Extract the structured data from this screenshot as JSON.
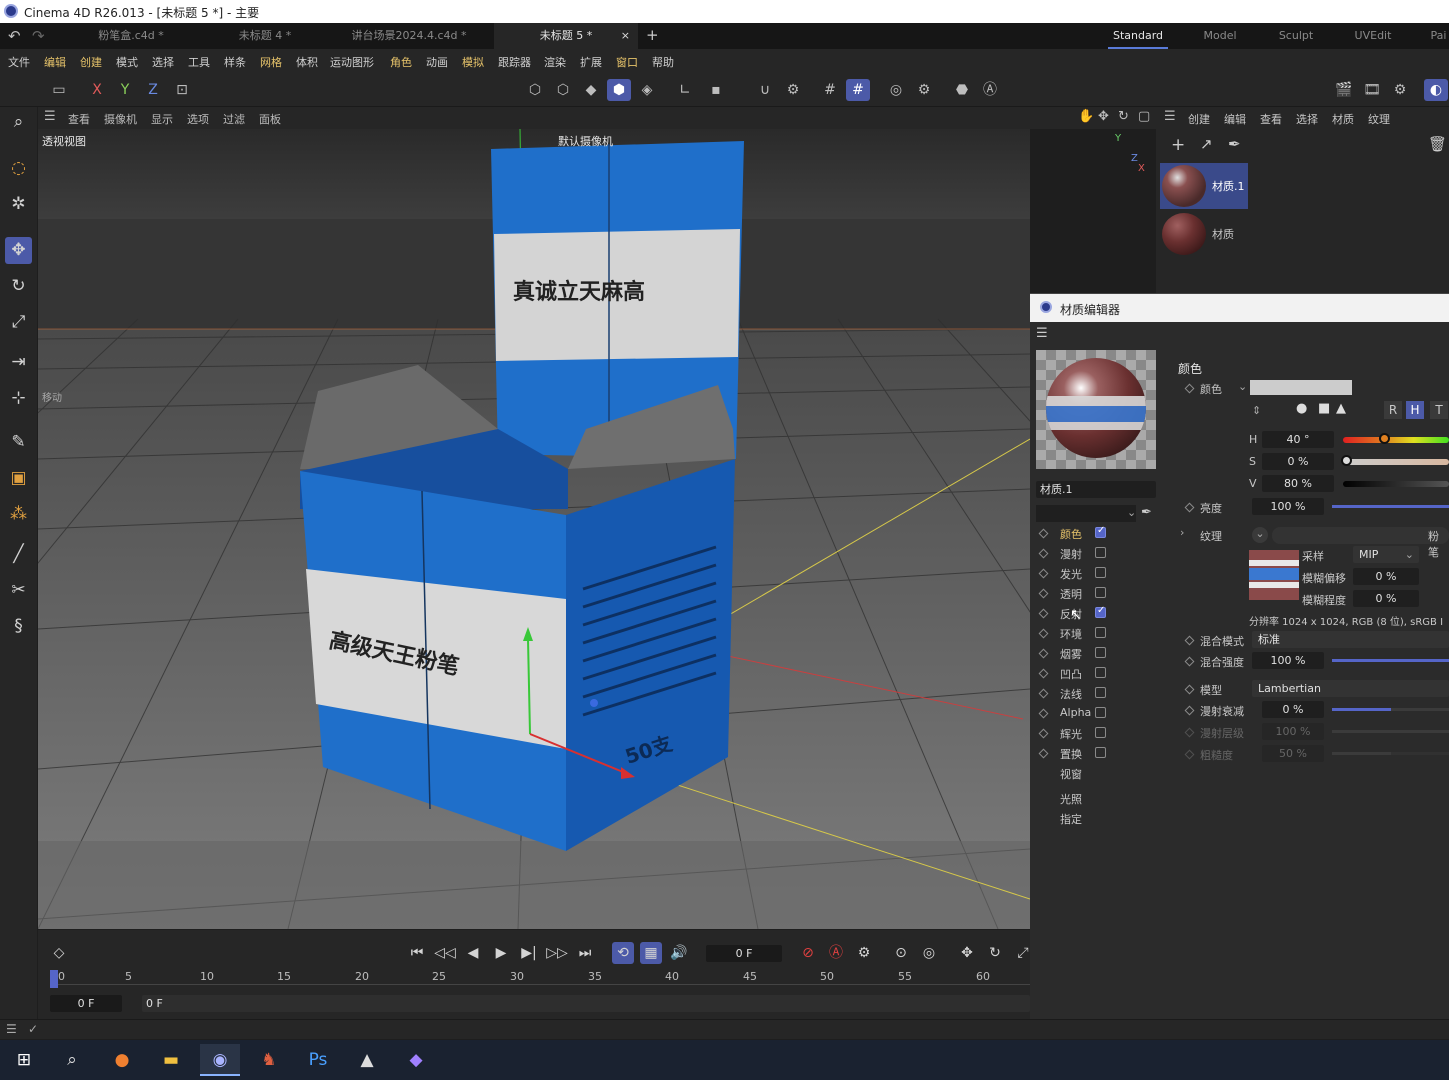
{
  "window": {
    "title": "Cinema 4D R26.013 - [未标题 5 *] - 主要"
  },
  "tabs": [
    {
      "label": "粉笔盒.c4d *",
      "active": false
    },
    {
      "label": "未标题 4 *",
      "active": false
    },
    {
      "label": "讲台场景2024.4.c4d *",
      "active": false
    },
    {
      "label": "未标题 5 *",
      "active": true
    }
  ],
  "tab_add": "+",
  "tab_close": "×",
  "layouts": [
    "Standard",
    "Model",
    "Sculpt",
    "UVEdit",
    "Pai"
  ],
  "menu": [
    "文件",
    "编辑",
    "创建",
    "模式",
    "选择",
    "工具",
    "样条",
    "网格",
    "体积",
    "运动图形",
    "角色",
    "动画",
    "模拟",
    "跟踪器",
    "渲染",
    "扩展",
    "窗口",
    "帮助"
  ],
  "axis_buttons": [
    "X",
    "Y",
    "Z"
  ],
  "viewport": {
    "menu": [
      "查看",
      "摄像机",
      "显示",
      "选项",
      "过滤",
      "面板"
    ],
    "view_name": "透视视图",
    "camera_label": "默认摄像机",
    "hud_label": "移动",
    "box_text_top": "真诚立天麻高",
    "box_text_front": "高级天王粉笔",
    "box_text_side": "50支",
    "axis_y": "Y",
    "axis_z": "Z",
    "axis_x": "X"
  },
  "material_manager": {
    "menu": [
      "创建",
      "编辑",
      "查看",
      "选择",
      "材质",
      "纹理"
    ],
    "materials": [
      {
        "name": "材质.1",
        "selected": true
      },
      {
        "name": "材质",
        "selected": false
      }
    ]
  },
  "material_editor": {
    "title": "材质编辑器",
    "material_name": "材质.1",
    "channels": [
      {
        "label": "颜色",
        "checked": true,
        "selected": true
      },
      {
        "label": "漫射",
        "checked": false
      },
      {
        "label": "发光",
        "checked": false
      },
      {
        "label": "透明",
        "checked": false
      },
      {
        "label": "反射",
        "checked": true
      },
      {
        "label": "环境",
        "checked": false
      },
      {
        "label": "烟雾",
        "checked": false
      },
      {
        "label": "凹凸",
        "checked": false
      },
      {
        "label": "法线",
        "checked": false
      },
      {
        "label": "Alpha",
        "checked": false
      },
      {
        "label": "辉光",
        "checked": false
      },
      {
        "label": "置换",
        "checked": false
      }
    ],
    "extra_items": [
      "视窗",
      "光照",
      "指定"
    ],
    "section_title": "颜色",
    "color_label": "颜色",
    "mode_buttons": [
      "R",
      "H",
      "T"
    ],
    "hsv": {
      "h_label": "H",
      "h_value": "40 °",
      "s_label": "S",
      "s_value": "0 %",
      "v_label": "V",
      "v_value": "80 %"
    },
    "brightness": {
      "label": "亮度",
      "value": "100 %",
      "level": 1.0
    },
    "texture": {
      "label": "纹理",
      "name": "粉笔"
    },
    "sampling": {
      "label": "采样",
      "value": "MIP"
    },
    "blur_offset": {
      "label": "模糊偏移",
      "value": "0 %"
    },
    "blur_scale": {
      "label": "模糊程度",
      "value": "0 %"
    },
    "resolution": "分辨率 1024 x 1024, RGB (8 位), sRGB I",
    "blend_mode": {
      "label": "混合模式",
      "value": "标准"
    },
    "blend_strength": {
      "label": "混合强度",
      "value": "100 %",
      "level": 1.0
    },
    "model": {
      "label": "模型",
      "value": "Lambertian"
    },
    "diffuse_falloff": {
      "label": "漫射衰减",
      "value": "0 %",
      "level": 0.5
    },
    "diffuse_level": {
      "label": "漫射层级",
      "value": "100 %",
      "level": 1.0
    },
    "roughness": {
      "label": "粗糙度",
      "value": "50 %",
      "level": 0.5
    }
  },
  "timeline": {
    "frame_display": "0 F",
    "ticks": [
      "0",
      "5",
      "10",
      "15",
      "20",
      "25",
      "30",
      "35",
      "40",
      "45",
      "50",
      "55",
      "60"
    ],
    "start_frame": "0 F",
    "current_frame": "0 F"
  },
  "colors": {
    "accent": "#4c5aa8",
    "highlight_text": "#e6c36a",
    "box_blue": "#1e6fc8",
    "box_label": "#d8d8d8"
  }
}
